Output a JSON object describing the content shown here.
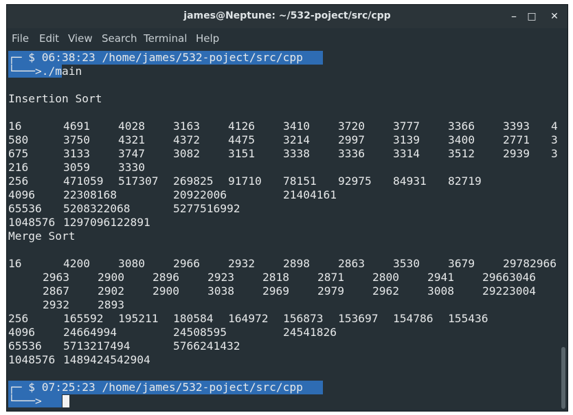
{
  "window": {
    "title": "james@Neptune: ~/532-poject/src/cpp",
    "controls": {
      "minimize": "–",
      "maximize": "□",
      "close": "✕"
    }
  },
  "menu": [
    "File",
    "Edit",
    "View",
    "Search",
    "Terminal",
    "Help"
  ],
  "prompt1": {
    "corner": "┌─",
    "text": "$ 06:38:23 /home/james/532-poject/src/cpp",
    "arrow": "└───>",
    "command": "./main"
  },
  "insertion": {
    "heading": "Insertion Sort",
    "rows": [
      [
        "16",
        "4691",
        "4028",
        "3163",
        "4126",
        "3410",
        "3720",
        "3777",
        "3366",
        "3393",
        "4"
      ],
      [
        "580",
        "3750",
        "4321",
        "4372",
        "4475",
        "3214",
        "2997",
        "3139",
        "3400",
        "2771",
        "3"
      ],
      [
        "675",
        "3133",
        "3747",
        "3082",
        "3151",
        "3338",
        "3336",
        "3314",
        "3512",
        "2939",
        "3"
      ],
      [
        "216",
        "3059",
        "3330"
      ],
      [
        "256",
        "471059",
        "517307",
        "269825",
        "91710",
        "78151",
        "92975",
        "84931",
        "82719"
      ],
      [
        "4096",
        "22308168",
        "",
        "20922006",
        "",
        "21404161"
      ],
      [
        "65536",
        "5208322068",
        "",
        "5277516992"
      ],
      [
        "1048576",
        "1297096122891"
      ]
    ]
  },
  "merge": {
    "heading": "Merge Sort",
    "row16": [
      "16",
      "4200",
      "3080",
      "2966",
      "2932",
      "2898",
      "2863",
      "3530",
      "3679",
      "29782966"
    ],
    "wrap_rows": [
      [
        "2963",
        "2900",
        "2896",
        "2923",
        "2818",
        "2871",
        "2800",
        "2941",
        "29663046"
      ],
      [
        "2867",
        "2902",
        "2900",
        "3038",
        "2969",
        "2979",
        "2962",
        "3008",
        "29223004"
      ],
      [
        "2932",
        "2893"
      ]
    ],
    "rows": [
      [
        "256",
        "165592",
        "195211",
        "180584",
        "164972",
        "156873",
        "153697",
        "154786",
        "155436"
      ],
      [
        "4096",
        "24664994",
        "",
        "24508595",
        "",
        "24541826"
      ],
      [
        "65536",
        "5713217494",
        "",
        "5766241432"
      ],
      [
        "1048576",
        "1489424542904"
      ]
    ]
  },
  "prompt2": {
    "corner": "┌─",
    "text": "$ 07:25:23 /home/james/532-poject/src/cpp",
    "arrow": "└───>"
  },
  "colors": {
    "background": "#263036",
    "prompt_highlight": "#2e6cb3",
    "text": "#e6e8e9"
  }
}
